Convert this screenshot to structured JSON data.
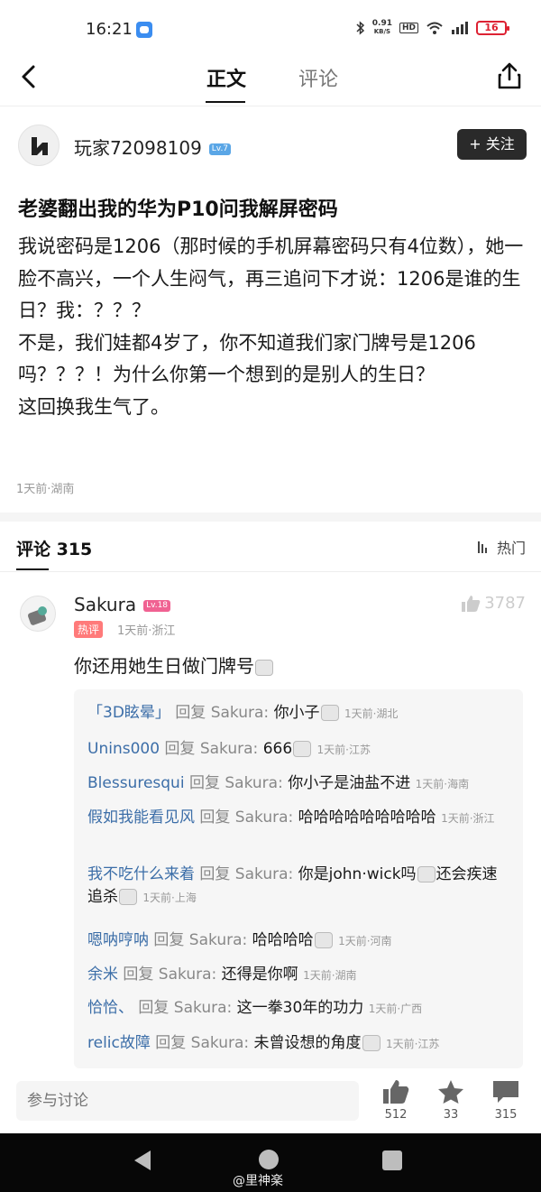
{
  "status_bar": {
    "time": "16:21",
    "net_speed_value": "0.91",
    "net_speed_unit": "KB/S",
    "hd_label": "HD",
    "battery": "16"
  },
  "nav": {
    "tab_main": "正文",
    "tab_comments": "评论"
  },
  "author": {
    "name": "玩家72098109",
    "level": "Lv.7",
    "follow_label": "+ 关注"
  },
  "post": {
    "title": "老婆翻出我的华为P10问我解屏密码",
    "paragraphs": [
      "我说密码是1206（那时候的手机屏幕密码只有4位数），她一脸不高兴，一个人生闷气，再三追问下才说：1206是谁的生日？我：？？？",
      "不是，我们娃都4岁了，你不知道我们家门牌号是1206吗？？？！为什么你第一个想到的是别人的生日？",
      "这回换我生气了。"
    ],
    "meta": "1天前·湖南"
  },
  "comments_section": {
    "label": "评论 315",
    "sort_label": "热门"
  },
  "top_comment": {
    "name": "Sakura",
    "level": "Lv.18",
    "tag": "热评",
    "meta": "1天前·浙江",
    "likes": "3787",
    "text": "你还用她生日做门牌号"
  },
  "replies": [
    {
      "author": "「3D眩晕」",
      "verb": "回复 Sakura:",
      "text": "你小子",
      "emoji": true,
      "text_after": "",
      "time": "1天前·湖北"
    },
    {
      "author": "Unins000",
      "verb": "回复 Sakura:",
      "text": "666",
      "emoji": true,
      "text_after": "",
      "time": "1天前·江苏"
    },
    {
      "author": "Blessuresqui",
      "verb": "回复 Sakura:",
      "text": "你小子是油盐不进",
      "emoji": false,
      "text_after": "",
      "time": "1天前·海南"
    },
    {
      "author": "假如我能看见风",
      "verb": "回复 Sakura:",
      "text": "哈哈哈哈哈哈哈哈哈",
      "emoji": false,
      "text_after": "",
      "time": "1天前·浙江"
    },
    {
      "author": "我不吃什么来着",
      "verb": "回复 Sakura:",
      "text": "你是john·wick吗",
      "emoji": true,
      "text_after": "还会疾速追杀",
      "emoji2": true,
      "time": "1天前·上海"
    },
    {
      "author": "嗯呐哼呐",
      "verb": "回复 Sakura:",
      "text": "哈哈哈哈",
      "emoji": true,
      "text_after": "",
      "time": "1天前·河南"
    },
    {
      "author": "余米",
      "verb": "回复 Sakura:",
      "text": "还得是你啊",
      "emoji": false,
      "text_after": "",
      "time": "1天前·湖南"
    },
    {
      "author": "恰恰、",
      "verb": "回复 Sakura:",
      "text": "这一拳30年的功力",
      "emoji": false,
      "text_after": "",
      "time": "1天前·广西"
    },
    {
      "author": "relic故障",
      "verb": "回复 Sakura:",
      "text": "未曾设想的角度",
      "emoji": true,
      "text_after": "",
      "time": "1天前·江苏"
    }
  ],
  "bottom_bar": {
    "input_placeholder": "参与讨论",
    "likes": "512",
    "favorites": "33",
    "comments": "315"
  },
  "watermark": "@里神楽",
  "icons": {
    "back": "chevron-left-icon",
    "share": "share-icon",
    "sort": "bars-icon",
    "like": "thumbs-up-icon",
    "favorite": "star-icon",
    "comment": "speech-bubble-icon"
  }
}
